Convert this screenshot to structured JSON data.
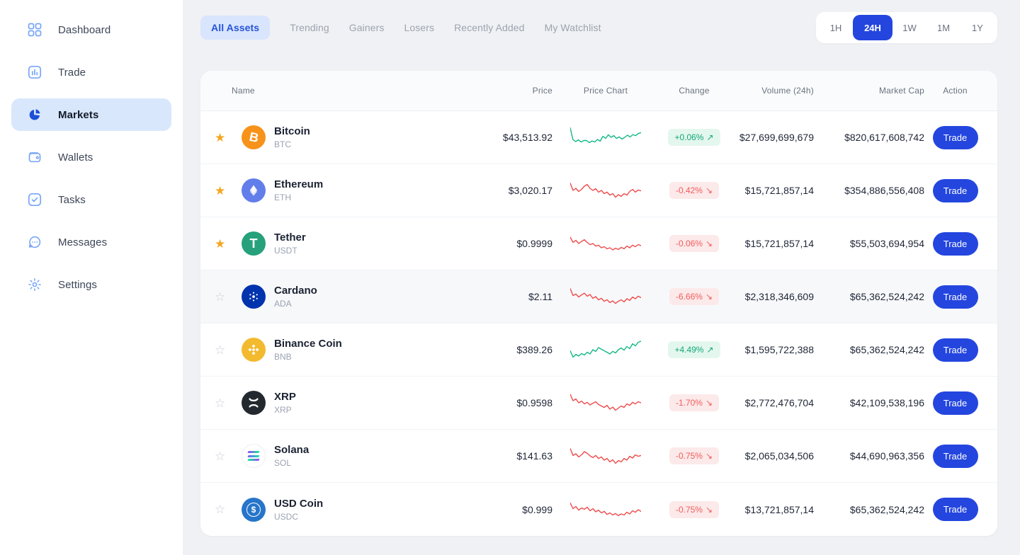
{
  "colors": {
    "accent_blue": "#2446DF",
    "active_pill_bg": "#D9E7FD",
    "tab_active_bg": "#D8E5FC",
    "tab_active_text": "#2653D9",
    "sidebar_icon_blue": "#78A6F8",
    "sidebar_icon_active": "#1D4ED8",
    "green_text": "#10A878",
    "green_bg": "#E4F7EE",
    "red_text": "#F25C5C",
    "red_bg": "#FCE9E9",
    "chart_green": "#12B886",
    "chart_red": "#EF4B4B",
    "star_gold": "#F4A621",
    "star_gray": "#C8CED8"
  },
  "sidebar": {
    "items": [
      {
        "label": "Dashboard",
        "icon": "dashboard-icon",
        "active": false
      },
      {
        "label": "Trade",
        "icon": "trade-icon",
        "active": false
      },
      {
        "label": "Markets",
        "icon": "markets-icon",
        "active": true
      },
      {
        "label": "Wallets",
        "icon": "wallets-icon",
        "active": false
      },
      {
        "label": "Tasks",
        "icon": "tasks-icon",
        "active": false
      },
      {
        "label": "Messages",
        "icon": "messages-icon",
        "active": false
      },
      {
        "label": "Settings",
        "icon": "settings-icon",
        "active": false
      }
    ]
  },
  "tabs": [
    {
      "label": "All Assets",
      "active": true
    },
    {
      "label": "Trending",
      "active": false
    },
    {
      "label": "Gainers",
      "active": false
    },
    {
      "label": "Losers",
      "active": false
    },
    {
      "label": "Recently Added",
      "active": false
    },
    {
      "label": "My Watchlist",
      "active": false
    }
  ],
  "timeframes": [
    {
      "label": "1H",
      "active": false
    },
    {
      "label": "24H",
      "active": true
    },
    {
      "label": "1W",
      "active": false
    },
    {
      "label": "1M",
      "active": false
    },
    {
      "label": "1Y",
      "active": false
    }
  ],
  "table": {
    "headers": [
      "Name",
      "Price",
      "Price Chart",
      "Change",
      "Volume (24h)",
      "Market Cap",
      "Action"
    ],
    "rows": [
      {
        "name": "Bitcoin",
        "symbol": "BTC",
        "icon": "btc",
        "icon_bg": "#F7931A",
        "starred": true,
        "highlighted": false,
        "price": "$43,513.92",
        "change": "+0.06%",
        "direction": "up",
        "volume": "$27,699,699,679",
        "market_cap": "$820,617,608,742",
        "action_label": "Trade",
        "spark": [
          0.95,
          0.4,
          0.3,
          0.38,
          0.28,
          0.35,
          0.35,
          0.25,
          0.33,
          0.28,
          0.4,
          0.32,
          0.55,
          0.45,
          0.62,
          0.5,
          0.58,
          0.45,
          0.52,
          0.42,
          0.5,
          0.6,
          0.52,
          0.63,
          0.58,
          0.68,
          0.72
        ]
      },
      {
        "name": "Ethereum",
        "symbol": "ETH",
        "icon": "eth",
        "icon_bg": "#627EEA",
        "starred": true,
        "highlighted": false,
        "price": "$3,020.17",
        "change": "-0.42%",
        "direction": "down",
        "volume": "$15,721,857,14",
        "market_cap": "$354,886,556,408",
        "action_label": "Trade",
        "spark": [
          0.85,
          0.5,
          0.6,
          0.45,
          0.55,
          0.7,
          0.78,
          0.6,
          0.5,
          0.58,
          0.42,
          0.5,
          0.35,
          0.42,
          0.28,
          0.35,
          0.18,
          0.3,
          0.22,
          0.35,
          0.28,
          0.45,
          0.55,
          0.42,
          0.52,
          0.48
        ]
      },
      {
        "name": "Tether",
        "symbol": "USDT",
        "icon": "usdt",
        "icon_bg": "#26A17B",
        "starred": true,
        "highlighted": false,
        "price": "$0.9999",
        "change": "-0.06%",
        "direction": "down",
        "volume": "$15,721,857,14",
        "market_cap": "$55,503,694,954",
        "action_label": "Trade",
        "spark": [
          0.8,
          0.55,
          0.65,
          0.5,
          0.6,
          0.68,
          0.55,
          0.45,
          0.5,
          0.38,
          0.42,
          0.3,
          0.35,
          0.25,
          0.3,
          0.2,
          0.28,
          0.22,
          0.32,
          0.25,
          0.38,
          0.3,
          0.42,
          0.35,
          0.45,
          0.4
        ]
      },
      {
        "name": "Cardano",
        "symbol": "ADA",
        "icon": "ada",
        "icon_bg": "#0033AD",
        "starred": false,
        "highlighted": true,
        "price": "$2.11",
        "change": "-6.66%",
        "direction": "down",
        "volume": "$2,318,346,609",
        "market_cap": "$65,362,524,242",
        "action_label": "Trade",
        "spark": [
          0.88,
          0.55,
          0.62,
          0.48,
          0.58,
          0.66,
          0.52,
          0.6,
          0.42,
          0.5,
          0.35,
          0.42,
          0.28,
          0.35,
          0.22,
          0.3,
          0.18,
          0.28,
          0.35,
          0.25,
          0.4,
          0.32,
          0.48,
          0.4,
          0.52,
          0.45
        ]
      },
      {
        "name": "Binance Coin",
        "symbol": "BNB",
        "icon": "bnb",
        "icon_bg": "#F3BA2F",
        "starred": false,
        "highlighted": false,
        "price": "$389.26",
        "change": "+4.49%",
        "direction": "up",
        "volume": "$1,595,722,388",
        "market_cap": "$65,362,524,242",
        "action_label": "Trade",
        "spark": [
          0.45,
          0.15,
          0.28,
          0.2,
          0.32,
          0.25,
          0.38,
          0.3,
          0.5,
          0.42,
          0.6,
          0.52,
          0.45,
          0.38,
          0.3,
          0.42,
          0.35,
          0.5,
          0.58,
          0.48,
          0.65,
          0.55,
          0.78,
          0.68,
          0.85,
          0.9
        ]
      },
      {
        "name": "XRP",
        "symbol": "XRP",
        "icon": "xrp",
        "icon_bg": "#23292F",
        "starred": false,
        "highlighted": false,
        "price": "$0.9598",
        "change": "-1.70%",
        "direction": "down",
        "volume": "$2,772,476,704",
        "market_cap": "$42,109,538,196",
        "action_label": "Trade",
        "spark": [
          0.9,
          0.6,
          0.68,
          0.5,
          0.58,
          0.45,
          0.52,
          0.4,
          0.48,
          0.55,
          0.42,
          0.35,
          0.28,
          0.38,
          0.2,
          0.3,
          0.15,
          0.25,
          0.35,
          0.28,
          0.45,
          0.38,
          0.52,
          0.45,
          0.55,
          0.5
        ]
      },
      {
        "name": "Solana",
        "symbol": "SOL",
        "icon": "sol",
        "icon_bg": "#FFFFFF",
        "starred": false,
        "highlighted": false,
        "price": "$141.63",
        "change": "-0.75%",
        "direction": "down",
        "volume": "$2,065,034,506",
        "market_cap": "$44,690,963,356",
        "action_label": "Trade",
        "spark": [
          0.85,
          0.52,
          0.6,
          0.45,
          0.55,
          0.7,
          0.62,
          0.5,
          0.42,
          0.52,
          0.38,
          0.45,
          0.3,
          0.38,
          0.22,
          0.32,
          0.15,
          0.28,
          0.22,
          0.38,
          0.3,
          0.48,
          0.4,
          0.55,
          0.48,
          0.52
        ]
      },
      {
        "name": "USD Coin",
        "symbol": "USDC",
        "icon": "usdc",
        "icon_bg": "#2775CA",
        "starred": false,
        "highlighted": false,
        "price": "$0.999",
        "change": "-0.75%",
        "direction": "down",
        "volume": "$13,721,857,14",
        "market_cap": "$65,362,524,242",
        "action_label": "Trade",
        "spark": [
          0.82,
          0.55,
          0.65,
          0.48,
          0.58,
          0.52,
          0.62,
          0.45,
          0.55,
          0.4,
          0.48,
          0.35,
          0.42,
          0.28,
          0.35,
          0.25,
          0.32,
          0.22,
          0.3,
          0.25,
          0.38,
          0.3,
          0.45,
          0.38,
          0.5,
          0.42
        ]
      }
    ]
  },
  "glyphs": {
    "arrow_up": "↗",
    "arrow_down": "↘",
    "star_filled": "★",
    "star_outline": "☆"
  }
}
